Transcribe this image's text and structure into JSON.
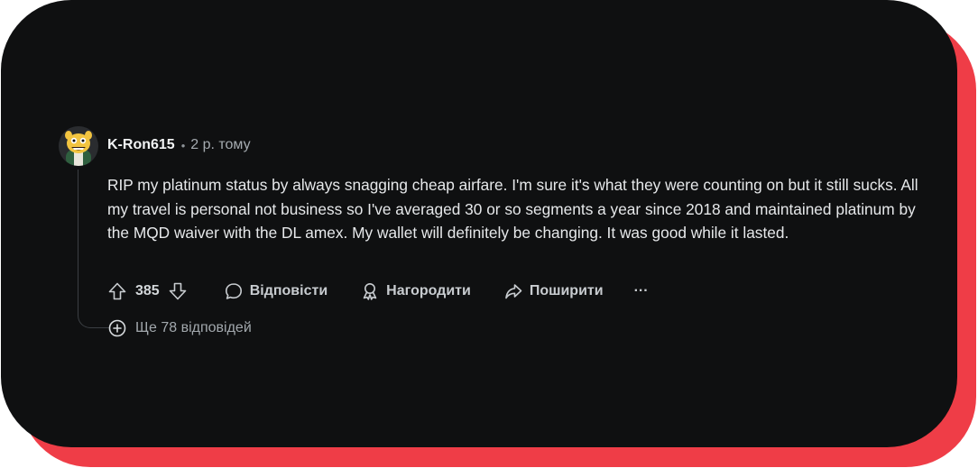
{
  "colors": {
    "card_background": "#0f1011",
    "shadow_accent": "#ef3d47",
    "text_primary": "#e6e8ea",
    "text_muted": "#a5abb0"
  },
  "comment": {
    "author": "K-Ron615",
    "separator": "•",
    "time": "2 р. тому",
    "avatar_icon": "snoo-avatar-icon",
    "body": "RIP my platinum status by always snagging cheap airfare. I'm sure it's what they were counting on but it still sucks. All my travel is personal not business so I've averaged 30 or so segments a year since 2018 and maintained platinum by the MQD waiver with the DL amex. My wallet will definitely be changing. It was good while it lasted.",
    "score": "385",
    "actions": {
      "reply_label": "Відповісти",
      "award_label": "Нагородити",
      "share_label": "Поширити",
      "more_label": "···"
    },
    "more_replies_label": "Ще 78 відповідей"
  }
}
